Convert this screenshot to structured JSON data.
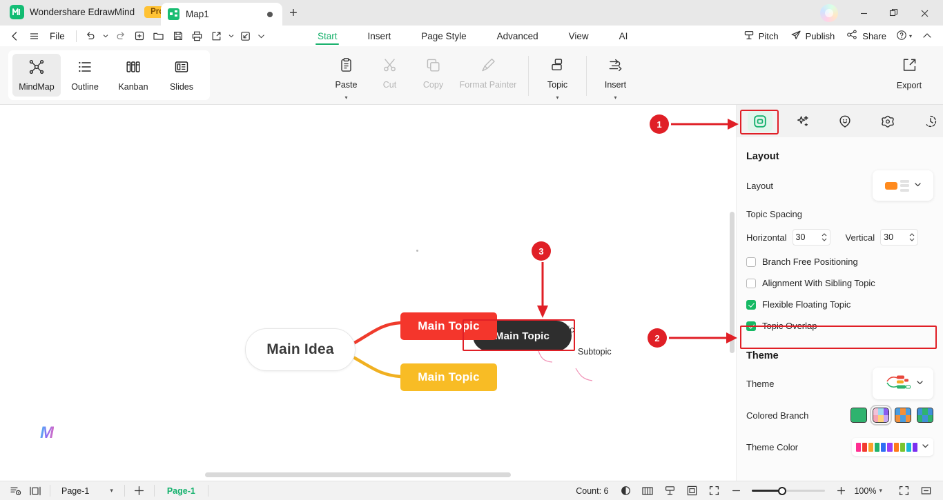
{
  "titlebar": {
    "brand_name": "Wondershare EdrawMind",
    "brand_logo_glyph": "M",
    "pro_badge": "Pro",
    "doc_tab": {
      "name": "Map1",
      "icon": "mindmap-icon",
      "modified_dot": "●"
    },
    "add_tab": "+",
    "window": {
      "minimize": "—",
      "restore": "❐",
      "close": "✕"
    }
  },
  "menurow": {
    "back": "‹",
    "hamburger": "☰",
    "file_label": "File",
    "quick_access": [
      {
        "name": "undo-icon",
        "glyph": "↶"
      },
      {
        "name": "undo-caret-icon",
        "glyph": "▾"
      },
      {
        "name": "redo-icon",
        "glyph": "↷"
      },
      {
        "name": "new-icon",
        "glyph": "⊞"
      },
      {
        "name": "open-icon",
        "glyph": "Ὄ1"
      },
      {
        "name": "save-icon",
        "glyph": "Ὃe"
      },
      {
        "name": "print-icon",
        "glyph": "⎙"
      },
      {
        "name": "export-share-icon",
        "glyph": "↗"
      },
      {
        "name": "export-caret-icon",
        "glyph": "▾"
      },
      {
        "name": "quick-action-icon",
        "glyph": "↘"
      },
      {
        "name": "more-caret-icon",
        "glyph": "⌄"
      }
    ],
    "tabs": [
      {
        "label": "Start",
        "active": true
      },
      {
        "label": "Insert",
        "active": false
      },
      {
        "label": "Page Style",
        "active": false
      },
      {
        "label": "Advanced",
        "active": false
      },
      {
        "label": "View",
        "active": false
      },
      {
        "label": "AI",
        "active": false
      }
    ],
    "right_items": [
      {
        "label": "Pitch",
        "icon": "pitch-icon"
      },
      {
        "label": "Publish",
        "icon": "publish-icon"
      },
      {
        "label": "Share",
        "icon": "share-icon"
      }
    ],
    "help_label": "?",
    "help_caret": "▾",
    "collapse_ribbon": "∧"
  },
  "ribbon": {
    "views": [
      {
        "label": "MindMap",
        "icon": "mindmap-view-icon",
        "selected": true
      },
      {
        "label": "Outline",
        "icon": "outline-view-icon",
        "selected": false
      },
      {
        "label": "Kanban",
        "icon": "kanban-view-icon",
        "selected": false
      },
      {
        "label": "Slides",
        "icon": "slides-view-icon",
        "selected": false
      }
    ],
    "commands": [
      {
        "label": "Paste",
        "icon": "paste-icon",
        "disabled": false,
        "caret": true
      },
      {
        "label": "Cut",
        "icon": "cut-icon",
        "disabled": true,
        "caret": false
      },
      {
        "label": "Copy",
        "icon": "copy-icon",
        "disabled": true,
        "caret": false
      },
      {
        "label": "Format Painter",
        "icon": "format-painter-icon",
        "disabled": true,
        "caret": false
      },
      {
        "label": "Topic",
        "icon": "topic-icon",
        "disabled": false,
        "caret": true
      },
      {
        "label": "Insert",
        "icon": "insert-icon",
        "disabled": false,
        "caret": true
      }
    ],
    "export": {
      "label": "Export",
      "icon": "export-icon"
    }
  },
  "canvas": {
    "nodes": [
      {
        "id": "main-idea",
        "text": "Main Idea",
        "style": "root"
      },
      {
        "id": "topic-red",
        "text": "Main Topic",
        "style": "red"
      },
      {
        "id": "topic-yellow",
        "text": "Main Topic",
        "style": "yellow"
      },
      {
        "id": "topic-dark",
        "text": "Main Topic",
        "style": "dark"
      }
    ],
    "subtopics": [
      {
        "text": "Subtopic"
      },
      {
        "text": "Subtopic"
      }
    ],
    "watermark": "M"
  },
  "panel": {
    "tabs": [
      {
        "name": "layout-panel-icon",
        "active": true
      },
      {
        "name": "ai-sparkle-icon",
        "active": false
      },
      {
        "name": "emoji-icon",
        "active": false
      },
      {
        "name": "sticker-icon",
        "active": false
      },
      {
        "name": "history-icon",
        "active": false
      }
    ],
    "layout_section": {
      "title": "Layout",
      "layout_label": "Layout",
      "spacing_title": "Topic Spacing",
      "horizontal_label": "Horizontal",
      "horizontal_value": "30",
      "vertical_label": "Vertical",
      "vertical_value": "30",
      "checkboxes": [
        {
          "label": "Branch Free Positioning",
          "checked": false
        },
        {
          "label": "Alignment With Sibling Topic",
          "checked": false
        },
        {
          "label": "Flexible Floating Topic",
          "checked": true
        },
        {
          "label": "Topic Overlap",
          "checked": true,
          "highlighted": true
        }
      ]
    },
    "theme_section": {
      "title": "Theme",
      "theme_label": "Theme",
      "colored_branch_label": "Colored Branch",
      "theme_color_label": "Theme Color",
      "theme_colors": [
        "#ff2f92",
        "#f23b2f",
        "#f9a12b",
        "#20b36b",
        "#2f6df4",
        "#9b3df5",
        "#ff7a1a",
        "#7ac42f",
        "#19b8d8",
        "#7a2ff0"
      ],
      "branch_selected_index": 1
    },
    "accent_color": "#16b964",
    "highlight_color": "#e01f26"
  },
  "statusbar": {
    "left_icons": [
      {
        "name": "outline-toggle-icon"
      },
      {
        "name": "pane-toggle-icon"
      }
    ],
    "page_select_value": "Page-1",
    "add_page": "+",
    "page_chip": "Page-1",
    "count_label": "Count: 6",
    "right_icons": [
      {
        "name": "mouse-mode-icon"
      },
      {
        "name": "book-mode-icon"
      },
      {
        "name": "pitch-mode-icon"
      },
      {
        "name": "fit-page-icon"
      },
      {
        "name": "fullscreen-icon"
      }
    ],
    "zoom_out": "−",
    "zoom_in": "+",
    "zoom_level": "100%",
    "zoom_caret": "▾",
    "focus_icon": "focus-mode-icon",
    "collapse_icon": "collapse-icon"
  },
  "annotations": [
    {
      "number": "1",
      "target": "layout-panel-tab"
    },
    {
      "number": "2",
      "target": "topic-overlap-checkbox"
    },
    {
      "number": "3",
      "target": "overlapping-topic-node"
    }
  ]
}
